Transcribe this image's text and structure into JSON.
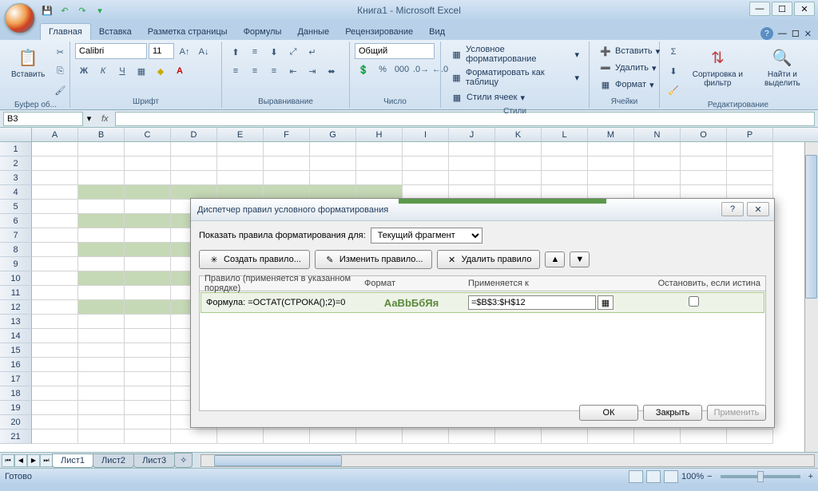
{
  "title": "Книга1 - Microsoft Excel",
  "tabs": {
    "home": "Главная",
    "insert": "Вставка",
    "layout": "Разметка страницы",
    "formulas": "Формулы",
    "data": "Данные",
    "review": "Рецензирование",
    "view": "Вид"
  },
  "ribbon": {
    "paste": "Вставить",
    "clipboard_title": "Буфер об...",
    "font_name": "Calibri",
    "font_size": "11",
    "font_title": "Шрифт",
    "align_title": "Выравнивание",
    "number_format": "Общий",
    "number_title": "Число",
    "cond_fmt": "Условное форматирование",
    "fmt_table": "Форматировать как таблицу",
    "cell_styles": "Стили ячеек",
    "styles_title": "Стили",
    "insert_cell": "Вставить",
    "delete_cell": "Удалить",
    "format_cell": "Формат",
    "cells_title": "Ячейки",
    "sort_filter": "Сортировка и фильтр",
    "find_select": "Найти и выделить",
    "editing_title": "Редактирование"
  },
  "name_box": "B3",
  "columns": [
    "A",
    "B",
    "C",
    "D",
    "E",
    "F",
    "G",
    "H",
    "I",
    "J",
    "K",
    "L",
    "M",
    "N",
    "O",
    "P"
  ],
  "rows": [
    "1",
    "2",
    "3",
    "4",
    "5",
    "6",
    "7",
    "8",
    "9",
    "10",
    "11",
    "12",
    "13",
    "14",
    "15",
    "16",
    "17",
    "18",
    "19",
    "20",
    "21"
  ],
  "dialog": {
    "title": "Диспетчер правил условного форматирования",
    "show_rules_label": "Показать правила форматирования для:",
    "show_rules_value": "Текущий фрагмент",
    "new_rule": "Создать правило...",
    "edit_rule": "Изменить правило...",
    "delete_rule": "Удалить правило",
    "hdr_rule": "Правило (применяется в указанном порядке)",
    "hdr_format": "Формат",
    "hdr_applies": "Применяется к",
    "hdr_stop": "Остановить, если истина",
    "rule_text": "Формула: =ОСТАТ(СТРОКА();2)=0",
    "rule_preview": "АаВbБбЯя",
    "rule_range": "=$B$3:$H$12",
    "ok": "ОК",
    "close": "Закрыть",
    "apply": "Применить"
  },
  "sheets": {
    "s1": "Лист1",
    "s2": "Лист2",
    "s3": "Лист3"
  },
  "status": "Готово",
  "zoom": "100%"
}
